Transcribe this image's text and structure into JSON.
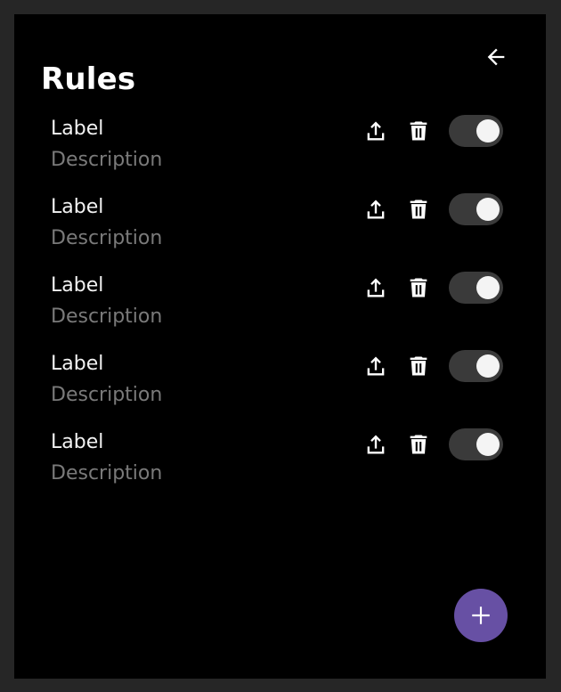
{
  "header": {
    "title": "Rules",
    "back_icon": "arrow-left-icon"
  },
  "rules": [
    {
      "label": "Label",
      "description": "Description",
      "enabled": true
    },
    {
      "label": "Label",
      "description": "Description",
      "enabled": true
    },
    {
      "label": "Label",
      "description": "Description",
      "enabled": true
    },
    {
      "label": "Label",
      "description": "Description",
      "enabled": true
    },
    {
      "label": "Label",
      "description": "Description",
      "enabled": true
    }
  ],
  "row_icons": {
    "upload": "upload-icon",
    "delete": "trash-icon"
  },
  "fab": {
    "icon": "plus-icon",
    "color": "#6750A4"
  },
  "colors": {
    "background": "#000000",
    "outer": "#262626",
    "label": "#F2F2F2",
    "description": "#7A7A7A",
    "toggle_track": "#3A3A3A",
    "toggle_knob": "#F4F4F4"
  }
}
